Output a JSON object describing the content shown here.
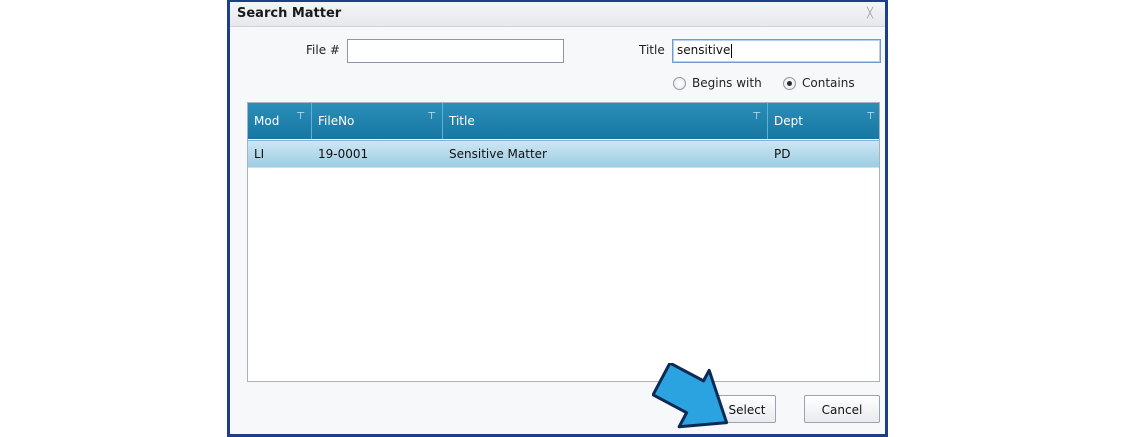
{
  "dialog": {
    "title": "Search Matter",
    "close_glyph": "╳"
  },
  "search": {
    "file_label": "File #",
    "file_value": "",
    "title_label": "Title",
    "title_value": "sensitive",
    "match_options": [
      {
        "label": "Begins with",
        "checked": false
      },
      {
        "label": "Contains",
        "checked": true
      }
    ]
  },
  "grid": {
    "columns": [
      "Mod",
      "FileNo",
      "Title",
      "Dept"
    ],
    "rows": [
      {
        "mod": "LI",
        "fileno": "19-0001",
        "title": "Sensitive Matter",
        "dept": "PD",
        "selected": true
      }
    ]
  },
  "buttons": {
    "select": "Select",
    "cancel": "Cancel"
  },
  "icons": {
    "filter": "filter-icon",
    "close": "close-icon",
    "pointer": "arrow-pointer-icon"
  },
  "colors": {
    "header": "#1e82ad",
    "selected_row": "#b6dcec",
    "dialog_border": "#1c3f8a",
    "arrow": "#2aa3e0"
  }
}
